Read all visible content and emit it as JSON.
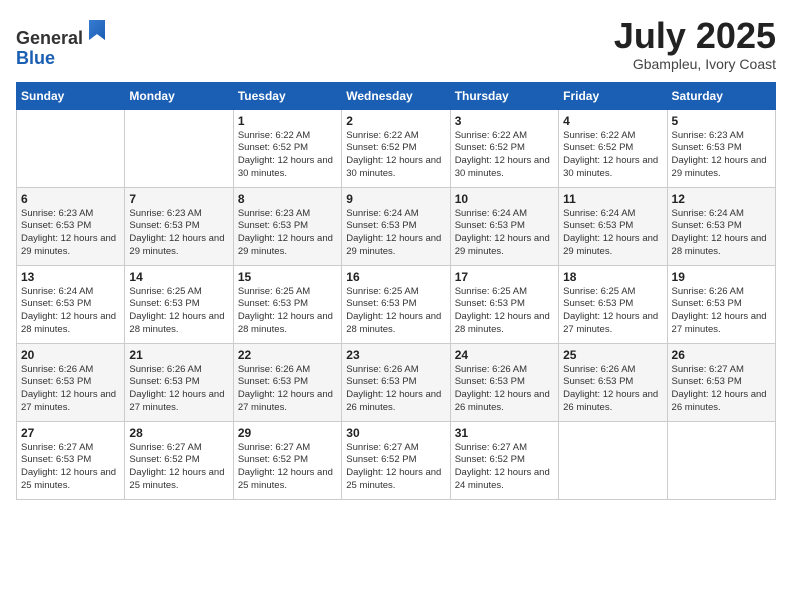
{
  "header": {
    "logo_line1": "General",
    "logo_line2": "Blue",
    "month_title": "July 2025",
    "location": "Gbampleu, Ivory Coast"
  },
  "days_of_week": [
    "Sunday",
    "Monday",
    "Tuesday",
    "Wednesday",
    "Thursday",
    "Friday",
    "Saturday"
  ],
  "weeks": [
    [
      {
        "day": "",
        "info": ""
      },
      {
        "day": "",
        "info": ""
      },
      {
        "day": "1",
        "sunrise": "6:22 AM",
        "sunset": "6:52 PM",
        "daylight": "12 hours and 30 minutes."
      },
      {
        "day": "2",
        "sunrise": "6:22 AM",
        "sunset": "6:52 PM",
        "daylight": "12 hours and 30 minutes."
      },
      {
        "day": "3",
        "sunrise": "6:22 AM",
        "sunset": "6:52 PM",
        "daylight": "12 hours and 30 minutes."
      },
      {
        "day": "4",
        "sunrise": "6:22 AM",
        "sunset": "6:52 PM",
        "daylight": "12 hours and 30 minutes."
      },
      {
        "day": "5",
        "sunrise": "6:23 AM",
        "sunset": "6:53 PM",
        "daylight": "12 hours and 29 minutes."
      }
    ],
    [
      {
        "day": "6",
        "sunrise": "6:23 AM",
        "sunset": "6:53 PM",
        "daylight": "12 hours and 29 minutes."
      },
      {
        "day": "7",
        "sunrise": "6:23 AM",
        "sunset": "6:53 PM",
        "daylight": "12 hours and 29 minutes."
      },
      {
        "day": "8",
        "sunrise": "6:23 AM",
        "sunset": "6:53 PM",
        "daylight": "12 hours and 29 minutes."
      },
      {
        "day": "9",
        "sunrise": "6:24 AM",
        "sunset": "6:53 PM",
        "daylight": "12 hours and 29 minutes."
      },
      {
        "day": "10",
        "sunrise": "6:24 AM",
        "sunset": "6:53 PM",
        "daylight": "12 hours and 29 minutes."
      },
      {
        "day": "11",
        "sunrise": "6:24 AM",
        "sunset": "6:53 PM",
        "daylight": "12 hours and 29 minutes."
      },
      {
        "day": "12",
        "sunrise": "6:24 AM",
        "sunset": "6:53 PM",
        "daylight": "12 hours and 28 minutes."
      }
    ],
    [
      {
        "day": "13",
        "sunrise": "6:24 AM",
        "sunset": "6:53 PM",
        "daylight": "12 hours and 28 minutes."
      },
      {
        "day": "14",
        "sunrise": "6:25 AM",
        "sunset": "6:53 PM",
        "daylight": "12 hours and 28 minutes."
      },
      {
        "day": "15",
        "sunrise": "6:25 AM",
        "sunset": "6:53 PM",
        "daylight": "12 hours and 28 minutes."
      },
      {
        "day": "16",
        "sunrise": "6:25 AM",
        "sunset": "6:53 PM",
        "daylight": "12 hours and 28 minutes."
      },
      {
        "day": "17",
        "sunrise": "6:25 AM",
        "sunset": "6:53 PM",
        "daylight": "12 hours and 28 minutes."
      },
      {
        "day": "18",
        "sunrise": "6:25 AM",
        "sunset": "6:53 PM",
        "daylight": "12 hours and 27 minutes."
      },
      {
        "day": "19",
        "sunrise": "6:26 AM",
        "sunset": "6:53 PM",
        "daylight": "12 hours and 27 minutes."
      }
    ],
    [
      {
        "day": "20",
        "sunrise": "6:26 AM",
        "sunset": "6:53 PM",
        "daylight": "12 hours and 27 minutes."
      },
      {
        "day": "21",
        "sunrise": "6:26 AM",
        "sunset": "6:53 PM",
        "daylight": "12 hours and 27 minutes."
      },
      {
        "day": "22",
        "sunrise": "6:26 AM",
        "sunset": "6:53 PM",
        "daylight": "12 hours and 27 minutes."
      },
      {
        "day": "23",
        "sunrise": "6:26 AM",
        "sunset": "6:53 PM",
        "daylight": "12 hours and 26 minutes."
      },
      {
        "day": "24",
        "sunrise": "6:26 AM",
        "sunset": "6:53 PM",
        "daylight": "12 hours and 26 minutes."
      },
      {
        "day": "25",
        "sunrise": "6:26 AM",
        "sunset": "6:53 PM",
        "daylight": "12 hours and 26 minutes."
      },
      {
        "day": "26",
        "sunrise": "6:27 AM",
        "sunset": "6:53 PM",
        "daylight": "12 hours and 26 minutes."
      }
    ],
    [
      {
        "day": "27",
        "sunrise": "6:27 AM",
        "sunset": "6:53 PM",
        "daylight": "12 hours and 25 minutes."
      },
      {
        "day": "28",
        "sunrise": "6:27 AM",
        "sunset": "6:52 PM",
        "daylight": "12 hours and 25 minutes."
      },
      {
        "day": "29",
        "sunrise": "6:27 AM",
        "sunset": "6:52 PM",
        "daylight": "12 hours and 25 minutes."
      },
      {
        "day": "30",
        "sunrise": "6:27 AM",
        "sunset": "6:52 PM",
        "daylight": "12 hours and 25 minutes."
      },
      {
        "day": "31",
        "sunrise": "6:27 AM",
        "sunset": "6:52 PM",
        "daylight": "12 hours and 24 minutes."
      },
      {
        "day": "",
        "info": ""
      },
      {
        "day": "",
        "info": ""
      }
    ]
  ]
}
